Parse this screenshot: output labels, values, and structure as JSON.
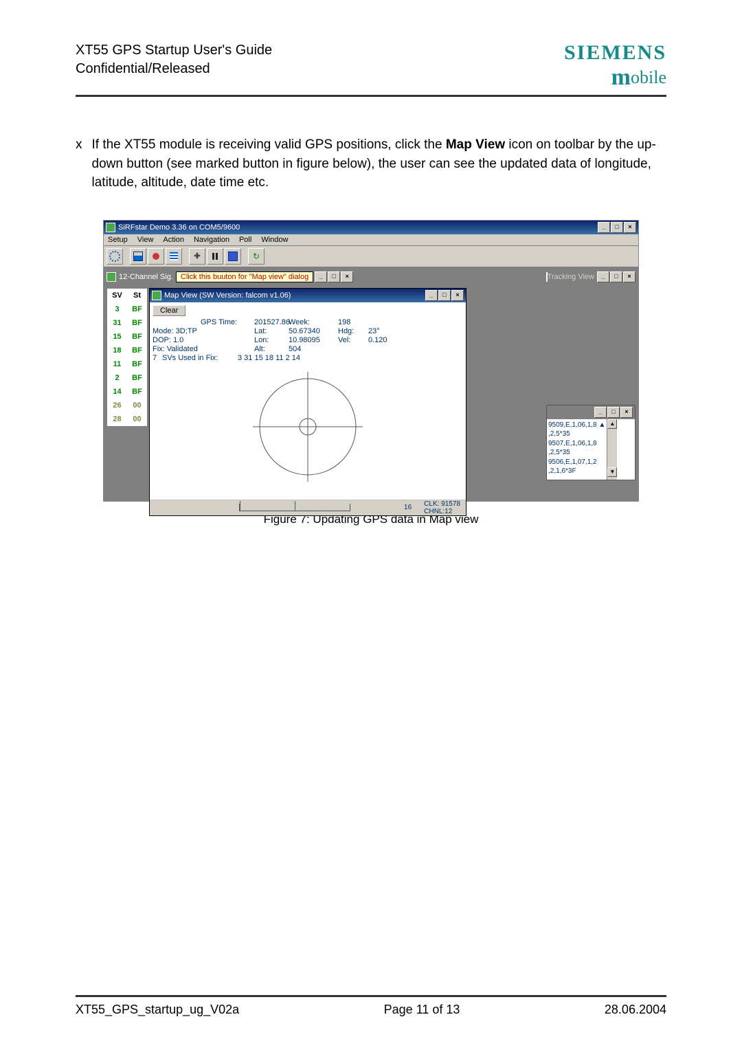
{
  "header": {
    "title_line1": "XT55 GPS Startup User's Guide",
    "title_line2": "Confidential/Released",
    "brand_main": "SIEMENS",
    "brand_sub_pre": "",
    "brand_sub_m": "m",
    "brand_sub_rest": "obile"
  },
  "body": {
    "bullet_mark": "x",
    "para_pre": "If the XT55 module is receiving valid GPS positions, click the ",
    "para_bold": "Map View",
    "para_post": " icon on toolbar by the up-down button (see marked button in figure below), the user can see the updated data of longitude, latitude, altitude, date time etc."
  },
  "caption": "Figure 7: Updating GPS data in Map view",
  "shot": {
    "main_title": "SiRFstar Demo 3.36 on COM5/9600",
    "menus": [
      "Setup",
      "View",
      "Action",
      "Navigation",
      "Poll",
      "Window"
    ],
    "win_min": "_",
    "win_max": "□",
    "win_close": "×",
    "strip": {
      "ch_title": "12-Channel Sig.",
      "hint": "Click this buuton for \"Map view\" dialog",
      "track_title": "Tracking View"
    },
    "sv": {
      "h1": "SV",
      "h2": "St",
      "rows": [
        {
          "sv": "3",
          "st": "BF"
        },
        {
          "sv": "31",
          "st": "BF"
        },
        {
          "sv": "15",
          "st": "BF"
        },
        {
          "sv": "18",
          "st": "BF"
        },
        {
          "sv": "11",
          "st": "BF"
        },
        {
          "sv": "2",
          "st": "BF"
        },
        {
          "sv": "14",
          "st": "BF"
        },
        {
          "sv": "26",
          "st": "00"
        },
        {
          "sv": "28",
          "st": "00"
        }
      ]
    },
    "mapwin": {
      "title": "Map View (SW Version: falcom v1.06)",
      "clear": "Clear",
      "labels": {
        "gps_time": "GPS Time:",
        "week": "Week:",
        "mode": "Mode:",
        "lat": "Lat:",
        "hdg": "Hdg:",
        "dop": "DOP:",
        "lon": "Lon:",
        "vel": "Vel:",
        "fix": "Fix:",
        "alt": "Alt:",
        "svs": "SVs Used in Fix:"
      },
      "values": {
        "gps_time": "201527.86",
        "week": "198",
        "mode": "3D;TP",
        "lat": "50.67340",
        "hdg": "23°",
        "dop": "1.0",
        "lon": "10.98095",
        "vel": "0.120",
        "fix": "Validated",
        "alt": "504",
        "svs_count": "7",
        "svs_list": "3 31 15 18 11 2 14"
      },
      "ruler_label": "16",
      "clk": "CLK: 91578",
      "chnl": "CHNL:12"
    },
    "track_lines": [
      "9509,E,1,06,1,8 ▲",
      ",2,5*35",
      "9507,E,1,06,1,8",
      ",2,5*35",
      "9506,E,1,07,1,2",
      ",2,1,6*3F"
    ]
  },
  "footer": {
    "left": "XT55_GPS_startup_ug_V02a",
    "center": "Page 11 of 13",
    "right": "28.06.2004"
  }
}
